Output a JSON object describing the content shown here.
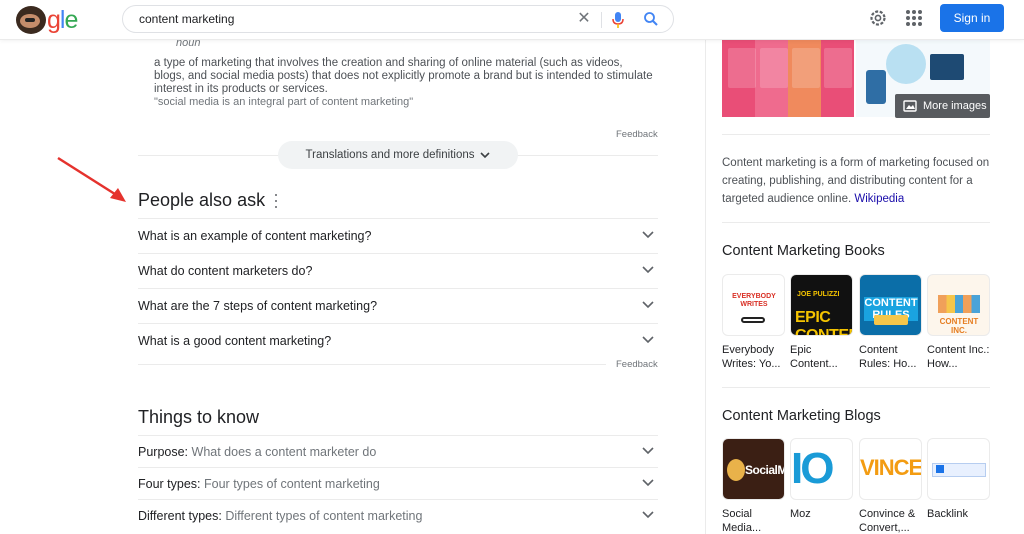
{
  "header": {
    "search_query": "content marketing",
    "signin_label": "Sign in",
    "colors": {
      "accent": "#1a73e8"
    }
  },
  "definition": {
    "part_of_speech": "noun",
    "text": "a type of marketing that involves the creation and sharing of online material (such as videos, blogs, and social media posts) that does not explicitly promote a brand but is intended to stimulate interest in its products or services.",
    "example": "\"social media is an integral part of content marketing\"",
    "feedback": "Feedback",
    "translations_label": "Translations and more definitions"
  },
  "people_also_ask": {
    "title": "People also ask",
    "questions": [
      "What is an example of content marketing?",
      "What do content marketers do?",
      "What are the 7 steps of content marketing?",
      "What is a good content marketing?"
    ],
    "feedback": "Feedback"
  },
  "things_to_know": {
    "title": "Things to know",
    "items": [
      {
        "label": "Purpose:",
        "value": "What does a content marketer do"
      },
      {
        "label": "Four types:",
        "value": "Four types of content marketing"
      },
      {
        "label": "Different types:",
        "value": "Different types of content marketing"
      }
    ]
  },
  "knowledge_panel": {
    "more_images": "More images",
    "description": "Content marketing is a form of marketing focused on creating, publishing, and distributing content for a targeted audience online.",
    "source_link": "Wikipedia",
    "books": {
      "title": "Content Marketing Books",
      "items": [
        {
          "caption": "Everybody Writes: Yo...",
          "cover_text": "EVERYBODY WRITES"
        },
        {
          "caption": "Epic Content...",
          "cover_top": "JOE PULIZZI",
          "cover_text": "EPIC CONTENT"
        },
        {
          "caption": "Content Rules: Ho...",
          "cover_text": "CONTENT RULES"
        },
        {
          "caption": "Content Inc.: How...",
          "cover_text": "CONTENT INC."
        }
      ]
    },
    "blogs": {
      "title": "Content Marketing Blogs",
      "items": [
        {
          "caption": "Social Media...",
          "logo_text": "SocialM"
        },
        {
          "caption": "Moz",
          "logo_text": "IO"
        },
        {
          "caption": "Convince & Convert,...",
          "logo_text": "VINCE"
        },
        {
          "caption": "Backlink"
        }
      ]
    }
  }
}
